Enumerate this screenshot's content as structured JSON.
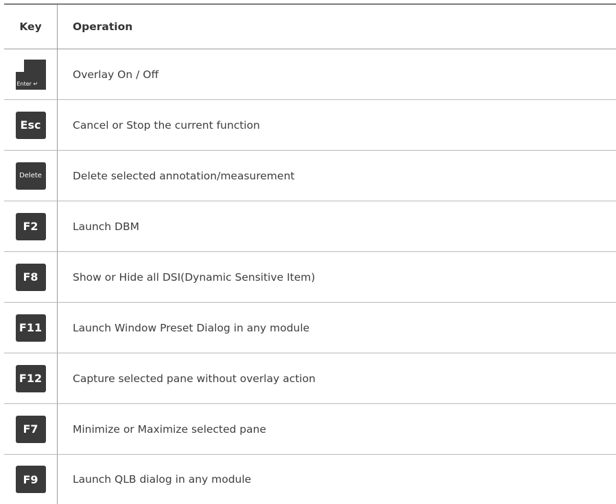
{
  "header": {
    "key_label": "Key",
    "operation_label": "Operation"
  },
  "rows": [
    {
      "key": "Enter ↵",
      "operation": "Overlay On / Off"
    },
    {
      "key": "Esc",
      "operation": "Cancel or Stop the current function"
    },
    {
      "key": "Delete",
      "operation": "Delete selected annotation/measurement"
    },
    {
      "key": "F2",
      "operation": "Launch DBM"
    },
    {
      "key": "F8",
      "operation": "Show or Hide all DSI(Dynamic Sensitive Item)"
    },
    {
      "key": "F11",
      "operation": "Launch Window Preset Dialog in any module"
    },
    {
      "key": "F12",
      "operation": "Capture selected pane without overlay action"
    },
    {
      "key": "F7",
      "operation": "Minimize or Maximize selected pane"
    },
    {
      "key": "F9",
      "operation": "Launch QLB dialog in any module"
    }
  ],
  "colors": {
    "keycap": "#3a3a3a",
    "rule": "#7a7a7a",
    "divider": "#b8b8b8"
  }
}
